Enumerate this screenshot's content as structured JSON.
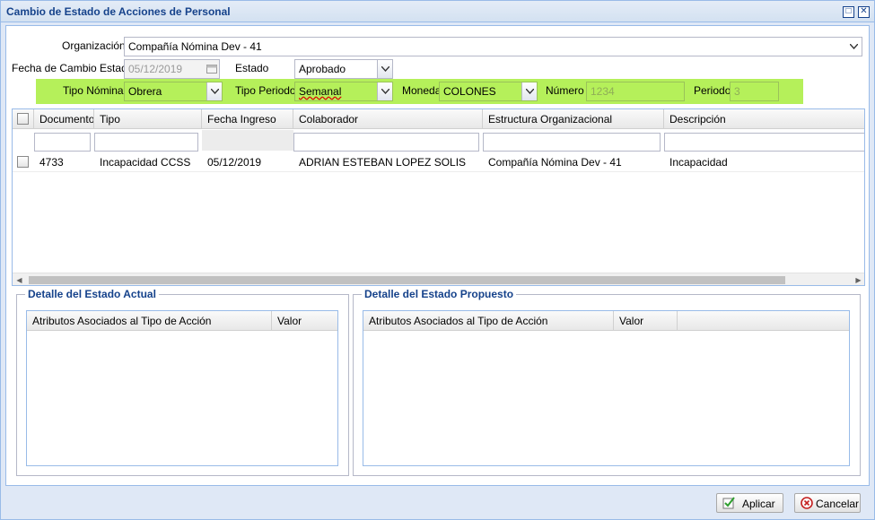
{
  "window": {
    "title": "Cambio de Estado de Acciones de Personal",
    "maximize_glyph": "□",
    "close_glyph": "✕"
  },
  "form": {
    "organizacion_label": "Organización",
    "organizacion_value": "Compañía Nómina Dev - 41",
    "fecha_label": "Fecha de Cambio Estado",
    "fecha_value": "05/12/2019",
    "estado_label": "Estado",
    "estado_value": "Aprobado",
    "tipo_nomina_label": "Tipo Nómina",
    "tipo_nomina_value": "Obrera",
    "tipo_periodo_label": "Tipo Periodo",
    "tipo_periodo_value": "Semanal",
    "moneda_label": "Moneda",
    "moneda_value": "COLONES",
    "numero_label": "Número",
    "numero_value": "1234",
    "periodo_label": "Periodo",
    "periodo_value": "3"
  },
  "grid": {
    "columns": [
      "Documento",
      "Tipo",
      "Fecha Ingreso",
      "Colaborador",
      "Estructura Organizacional",
      "Descripción"
    ],
    "rows": [
      {
        "documento": "4733",
        "tipo": "Incapacidad CCSS",
        "fecha_ingreso": "05/12/2019",
        "colaborador": "ADRIAN ESTEBAN LOPEZ SOLIS",
        "estructura": "Compañía Nómina Dev - 41",
        "descripcion": "Incapacidad"
      }
    ]
  },
  "detalle_actual": {
    "legend": "Detalle del Estado Actual",
    "col_atributos": "Atributos Asociados al Tipo de Acción",
    "col_valor": "Valor"
  },
  "detalle_propuesto": {
    "legend": "Detalle del Estado Propuesto",
    "col_atributos": "Atributos Asociados al Tipo de Acción",
    "col_valor": "Valor"
  },
  "buttons": {
    "aplicar": "Aplicar",
    "cancelar": "Cancelar"
  },
  "colors": {
    "highlight_green": "#b5f05a",
    "title_blue": "#15428b",
    "border_blue": "#99bbe8"
  }
}
